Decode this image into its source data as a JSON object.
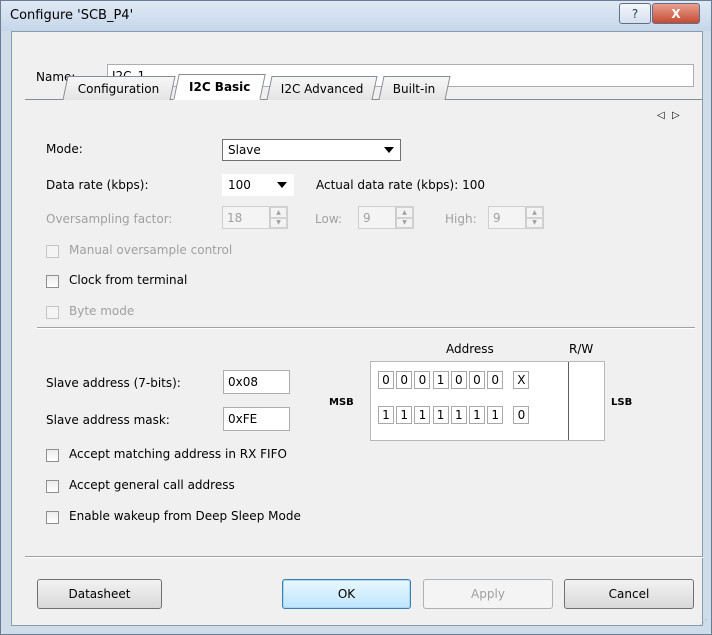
{
  "window": {
    "title": "Configure 'SCB_P4'",
    "help_glyph": "?",
    "close_glyph": "X"
  },
  "name_field": {
    "label": "Name:",
    "value": "I2C_1"
  },
  "tabs": [
    {
      "label": "Configuration"
    },
    {
      "label": "I2C Basic"
    },
    {
      "label": "I2C Advanced"
    },
    {
      "label": "Built-in"
    }
  ],
  "tab_scroll": {
    "left": "◁",
    "right": "▷"
  },
  "mode": {
    "label": "Mode:",
    "value": "Slave"
  },
  "data_rate": {
    "label": "Data rate (kbps):",
    "value": "100",
    "actual": "Actual data rate (kbps): 100"
  },
  "oversampling": {
    "label": "Oversampling factor:",
    "value": "18",
    "low_label": "Low:",
    "low_value": "9",
    "high_label": "High:",
    "high_value": "9"
  },
  "checkboxes_top": [
    {
      "label": "Manual oversample control",
      "checked": false,
      "enabled": false
    },
    {
      "label": "Clock from terminal",
      "checked": false,
      "enabled": true
    },
    {
      "label": "Byte mode",
      "checked": false,
      "enabled": false
    }
  ],
  "slave_address": {
    "label": "Slave address (7-bits):",
    "value": "0x08"
  },
  "slave_mask": {
    "label": "Slave address mask:",
    "value": "0xFE"
  },
  "bit_grid": {
    "address_header": "Address",
    "rw_header": "R/W",
    "msb": "MSB",
    "lsb": "LSB",
    "row1": [
      "0",
      "0",
      "0",
      "1",
      "0",
      "0",
      "0",
      "X"
    ],
    "row2": [
      "1",
      "1",
      "1",
      "1",
      "1",
      "1",
      "1",
      "0"
    ]
  },
  "checkboxes_bottom": [
    {
      "label": "Accept matching address in RX FIFO",
      "checked": false
    },
    {
      "label": "Accept general call address",
      "checked": false
    },
    {
      "label": "Enable wakeup from Deep Sleep Mode",
      "checked": false
    }
  ],
  "buttons": {
    "datasheet": "Datasheet",
    "ok": "OK",
    "apply": "Apply",
    "cancel": "Cancel"
  }
}
